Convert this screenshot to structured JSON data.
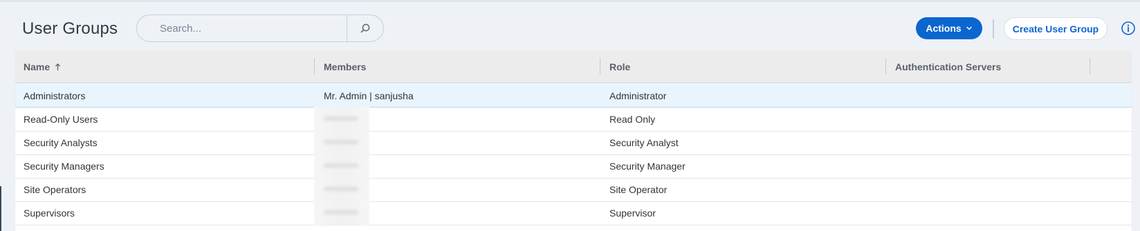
{
  "header": {
    "title": "User Groups",
    "search": {
      "placeholder": "Search...",
      "value": ""
    },
    "actions_label": "Actions",
    "create_label": "Create User Group"
  },
  "icons": {
    "search": "search-icon",
    "actions_chevron": "chevron-down-icon",
    "info": "info-icon",
    "sort": "sort-ascending-icon"
  },
  "colors": {
    "accent": "#0b66d0",
    "selected_row": "#e9f4fc",
    "header_bg": "#ececec",
    "page_bg": "#eef2f7"
  },
  "table": {
    "columns": [
      "Name",
      "Members",
      "Role",
      "Authentication Servers"
    ],
    "sort": {
      "column": "Name",
      "direction": "ascending"
    },
    "rows": [
      {
        "name": "Administrators",
        "members": "Mr. Admin | sanjusha",
        "role": "Administrator",
        "auth": "",
        "selected": true,
        "members_obscured": false
      },
      {
        "name": "Read-Only Users",
        "members": "",
        "role": "Read Only",
        "auth": "",
        "selected": false,
        "members_obscured": true
      },
      {
        "name": "Security Analysts",
        "members": "",
        "role": "Security Analyst",
        "auth": "",
        "selected": false,
        "members_obscured": true
      },
      {
        "name": "Security Managers",
        "members": "",
        "role": "Security Manager",
        "auth": "",
        "selected": false,
        "members_obscured": true
      },
      {
        "name": "Site Operators",
        "members": "",
        "role": "Site Operator",
        "auth": "",
        "selected": false,
        "members_obscured": true
      },
      {
        "name": "Supervisors",
        "members": "",
        "role": "Supervisor",
        "auth": "",
        "selected": false,
        "members_obscured": true
      }
    ]
  }
}
